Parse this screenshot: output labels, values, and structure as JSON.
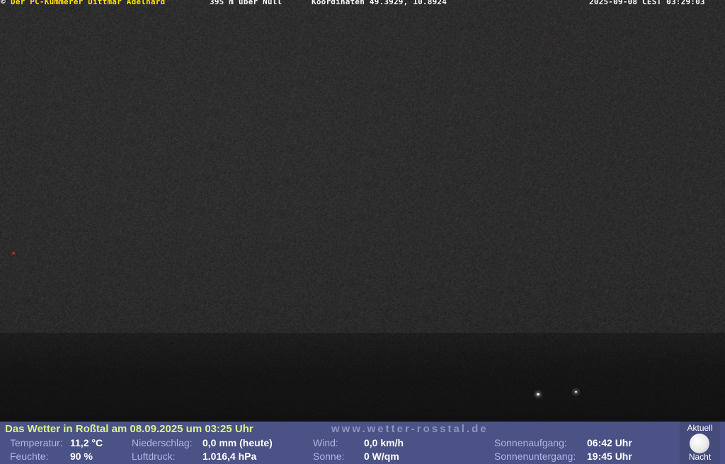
{
  "overlay": {
    "copyright": "©",
    "owner": "Der PC-Kümmerer Dittmar Adelhard",
    "altitude": "395 m über Null",
    "coordinates": "Koordinaten 49.3929, 10.8924",
    "timestamp": "2025-09-08 CEST 03:29:03"
  },
  "weather": {
    "headline": "Das Wetter in Roßtal am 08.09.2025 um 03:25 Uhr",
    "url": "www.wetter-rosstal.de",
    "temperature_label": "Temperatur:",
    "temperature_value": "11,2 °C",
    "humidity_label": "Feuchte:",
    "humidity_value": "90 %",
    "precip_label": "Niederschlag:",
    "precip_value": "0,0 mm (heute)",
    "pressure_label": "Luftdruck:",
    "pressure_value": "1.016,4 hPa",
    "wind_label": "Wind:",
    "wind_value": "0,0 km/h",
    "sun_label": "Sonne:",
    "sun_value": "0 W/qm",
    "sunrise_label": "Sonnenaufgang:",
    "sunrise_value": "06:42 Uhr",
    "sunset_label": "Sonnenuntergang:",
    "sunset_value": "19:45 Uhr",
    "moon_top": "Aktuell",
    "moon_bottom": "Nacht"
  },
  "colors": {
    "owner_text": "#ffe600",
    "weather_bar": "#4a5286",
    "headline": "#d8f58c"
  },
  "icons": {
    "moon": "full-moon-icon"
  }
}
